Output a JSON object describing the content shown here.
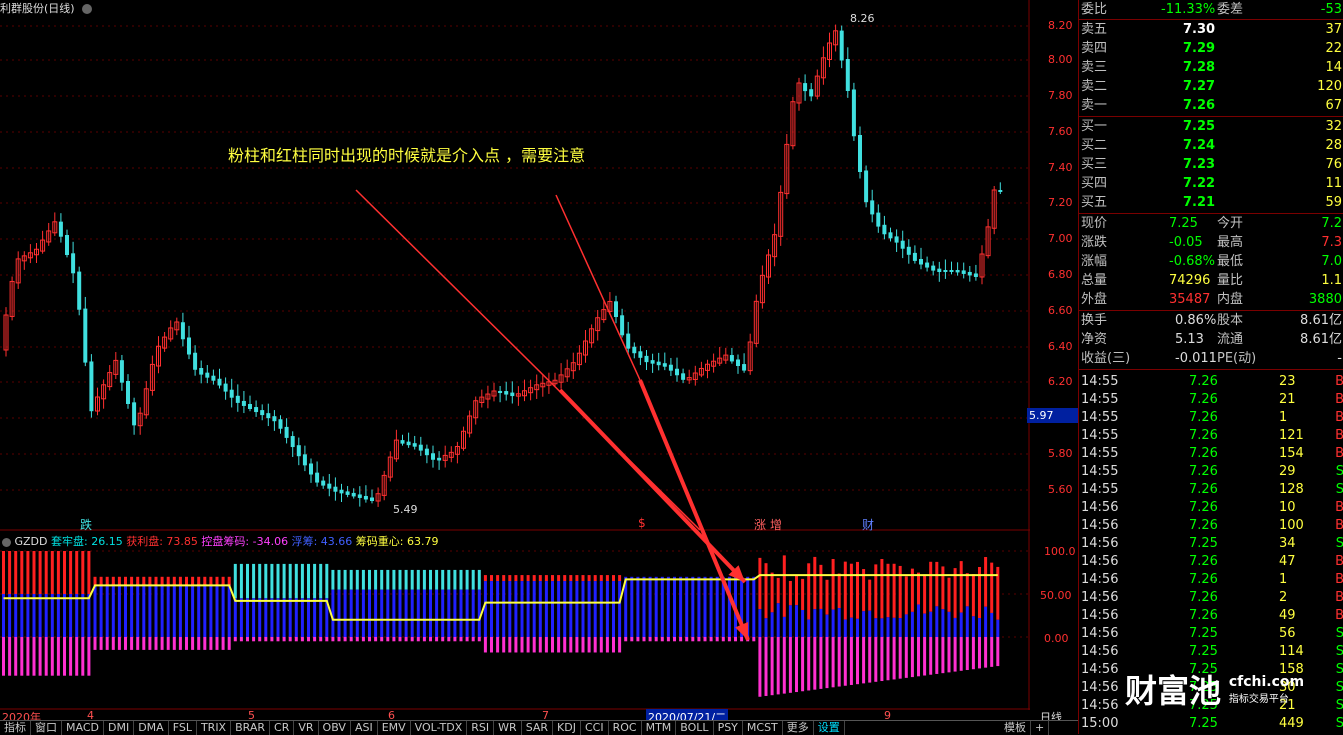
{
  "title": "利群股份(日线)",
  "annotation": "粉柱和红柱同时出现的时候就是介入点 ，需要注意",
  "price_axis": [
    "8.20",
    "8.00",
    "7.80",
    "7.60",
    "7.40",
    "7.20",
    "7.00",
    "6.80",
    "6.60",
    "6.40",
    "6.20",
    "6.00",
    "5.80",
    "5.60"
  ],
  "current_price_tag": "5.97",
  "high_label": "8.26",
  "low_label": "5.49",
  "signals": [
    "跌",
    "$",
    "涨",
    "增",
    "财"
  ],
  "indicator": {
    "name": "GZDD",
    "items": [
      {
        "label": "套牢盘: 26.15",
        "color": "#00e0e0"
      },
      {
        "label": "获利盘: 73.85",
        "color": "#ff3030"
      },
      {
        "label": "控盘筹码: -34.06",
        "color": "#ff40ff"
      },
      {
        "label": "浮筹: 43.66",
        "color": "#4060ff"
      },
      {
        "label": "筹码重心: 63.79",
        "color": "#ffff40"
      }
    ],
    "axis": [
      "100.0",
      "50.00",
      "0.00"
    ]
  },
  "date_axis": {
    "labels": [
      "2020年",
      "4",
      "5",
      "6",
      "7",
      "2020/07/21/二",
      "9"
    ],
    "period": "日线"
  },
  "tabs": [
    "指标",
    "窗口",
    "MACD",
    "DMI",
    "DMA",
    "FSL",
    "TRIX",
    "BRAR",
    "CR",
    "VR",
    "OBV",
    "ASI",
    "EMV",
    "VOL-TDX",
    "RSI",
    "WR",
    "SAR",
    "KDJ",
    "CCI",
    "ROC",
    "MTM",
    "BOLL",
    "PSY",
    "MCST",
    "更多",
    "设置"
  ],
  "tabs_right": [
    "模板",
    "+"
  ],
  "quote": {
    "weibi_label": "委比",
    "weibi": "-11.33%",
    "weicha_label": "委差",
    "weicha": "-53",
    "asks": [
      {
        "label": "卖五",
        "price": "7.30",
        "vol": "37"
      },
      {
        "label": "卖四",
        "price": "7.29",
        "vol": "22"
      },
      {
        "label": "卖三",
        "price": "7.28",
        "vol": "14"
      },
      {
        "label": "卖二",
        "price": "7.27",
        "vol": "120"
      },
      {
        "label": "卖一",
        "price": "7.26",
        "vol": "67"
      }
    ],
    "bids": [
      {
        "label": "买一",
        "price": "7.25",
        "vol": "32"
      },
      {
        "label": "买二",
        "price": "7.24",
        "vol": "28"
      },
      {
        "label": "买三",
        "price": "7.23",
        "vol": "76"
      },
      {
        "label": "买四",
        "price": "7.22",
        "vol": "11"
      },
      {
        "label": "买五",
        "price": "7.21",
        "vol": "59"
      }
    ],
    "stats": [
      {
        "l1": "现价",
        "v1": "7.25",
        "c1": "#00ff00",
        "l2": "今开",
        "v2": "7.2",
        "c2": "#00ff00"
      },
      {
        "l1": "涨跌",
        "v1": "-0.05",
        "c1": "#00ff00",
        "l2": "最高",
        "v2": "7.3",
        "c2": "#ff3030"
      },
      {
        "l1": "涨幅",
        "v1": "-0.68%",
        "c1": "#00ff00",
        "l2": "最低",
        "v2": "7.0",
        "c2": "#00ff00"
      },
      {
        "l1": "总量",
        "v1": "74296",
        "c1": "#ffff40",
        "l2": "量比",
        "v2": "1.1",
        "c2": "#ffff40"
      },
      {
        "l1": "外盘",
        "v1": "35487",
        "c1": "#ff3030",
        "l2": "内盘",
        "v2": "3880",
        "c2": "#00ff00"
      }
    ],
    "fundamentals": [
      {
        "l1": "换手",
        "v1": "0.86%",
        "l2": "股本",
        "v2": "8.61亿"
      },
      {
        "l1": "净资",
        "v1": "5.13",
        "l2": "流通",
        "v2": "8.61亿"
      },
      {
        "l1": "收益(三)",
        "v1": "-0.011",
        "l2": "PE(动)",
        "v2": "-"
      }
    ],
    "ticks": [
      {
        "time": "14:55",
        "price": "7.26",
        "vol": "23",
        "bs": "B"
      },
      {
        "time": "14:55",
        "price": "7.26",
        "vol": "21",
        "bs": "B"
      },
      {
        "time": "14:55",
        "price": "7.26",
        "vol": "1",
        "bs": "B"
      },
      {
        "time": "14:55",
        "price": "7.26",
        "vol": "121",
        "bs": "B"
      },
      {
        "time": "14:55",
        "price": "7.26",
        "vol": "154",
        "bs": "B"
      },
      {
        "time": "14:55",
        "price": "7.26",
        "vol": "29",
        "bs": "S"
      },
      {
        "time": "14:55",
        "price": "7.26",
        "vol": "128",
        "bs": "S"
      },
      {
        "time": "14:56",
        "price": "7.26",
        "vol": "10",
        "bs": "B"
      },
      {
        "time": "14:56",
        "price": "7.26",
        "vol": "100",
        "bs": "B"
      },
      {
        "time": "14:56",
        "price": "7.25",
        "vol": "34",
        "bs": "S"
      },
      {
        "time": "14:56",
        "price": "7.26",
        "vol": "47",
        "bs": "B"
      },
      {
        "time": "14:56",
        "price": "7.26",
        "vol": "1",
        "bs": "B"
      },
      {
        "time": "14:56",
        "price": "7.26",
        "vol": "2",
        "bs": "B"
      },
      {
        "time": "14:56",
        "price": "7.26",
        "vol": "49",
        "bs": "B"
      },
      {
        "time": "14:56",
        "price": "7.25",
        "vol": "56",
        "bs": "S"
      },
      {
        "time": "14:56",
        "price": "7.25",
        "vol": "114",
        "bs": "S"
      },
      {
        "time": "14:56",
        "price": "7.25",
        "vol": "158",
        "bs": "S"
      },
      {
        "time": "14:56",
        "price": "7.25",
        "vol": "30",
        "bs": "S"
      },
      {
        "time": "14:56",
        "price": "7.25",
        "vol": "21",
        "bs": "S"
      },
      {
        "time": "15:00",
        "price": "7.25",
        "vol": "449",
        "bs": "S"
      }
    ]
  },
  "watermark": {
    "brand": "财富池",
    "site": "cfchi.com",
    "slogan": "指标交易平台"
  },
  "colors": {
    "up": "#ff3030",
    "down": "#40e0e0",
    "grid": "#7a0000",
    "avg": "#ffff40",
    "bar_blue": "#2020ff",
    "bar_pink": "#ff30d0"
  }
}
